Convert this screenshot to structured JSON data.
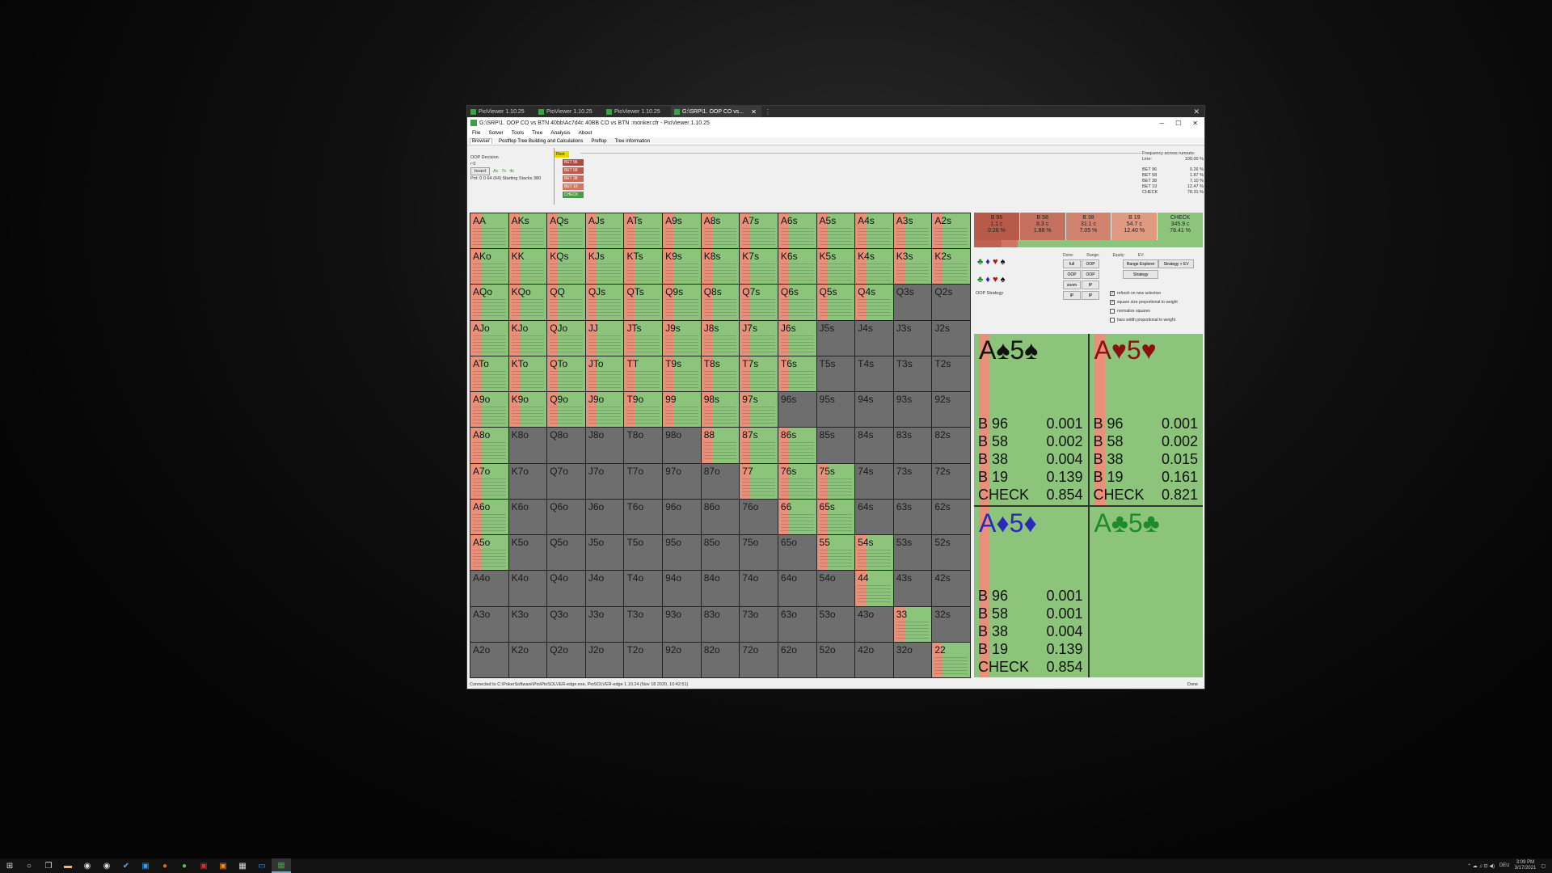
{
  "tabs": [
    {
      "label": "PioViewer 1.10.25",
      "active": false
    },
    {
      "label": "PioViewer 1.10.25",
      "active": false
    },
    {
      "label": "PioViewer 1.10.25",
      "active": false
    },
    {
      "label": "G:\\SRP\\1. OOP CO vs...",
      "active": true
    }
  ],
  "window_title": "G:\\SRP\\1. OOP CO vs BTN 40bb\\Ac7d4c 40BB CO vs BTN :monker.cfr - PioViewer 1.10.25",
  "menu": [
    "File",
    "Solver",
    "Tools",
    "Tree",
    "Analysis",
    "About"
  ],
  "subtabs": [
    "Browser",
    "Postflop Tree Building and Calculations",
    "Preflop",
    "Tree information"
  ],
  "info": {
    "decision": "OOP Decision",
    "line": "r:0",
    "board_btn": "board",
    "board_cards": [
      "Ac",
      "7c",
      "4c"
    ],
    "pot": "Pot: 0 0 64 (64) Starting Stacks 380"
  },
  "tree_nodes": [
    {
      "label": "Root",
      "color": "#e8d800"
    },
    {
      "label": "BET 96",
      "color": "#b04a3a"
    },
    {
      "label": "BET 58",
      "color": "#c05a48"
    },
    {
      "label": "BET 38",
      "color": "#c86a55"
    },
    {
      "label": "BET 19",
      "color": "#d07a65"
    },
    {
      "label": "CHECK",
      "color": "#4a9a4a"
    }
  ],
  "freq": {
    "title": "Frequency across runouts:",
    "line_label": "Line:",
    "line_value": "100.00 %",
    "rows": [
      {
        "name": "BET 96",
        "val": "0.26 %"
      },
      {
        "name": "BET 58",
        "val": "1.87 %"
      },
      {
        "name": "BET 38",
        "val": "7.10 %"
      },
      {
        "name": "BET 19",
        "val": "12.47 %"
      },
      {
        "name": "CHECK",
        "val": "78.31 %"
      }
    ]
  },
  "grid": [
    [
      "AA",
      "AKs",
      "AQs",
      "AJs",
      "ATs",
      "A9s",
      "A8s",
      "A7s",
      "A6s",
      "A5s",
      "A4s",
      "A3s",
      "A2s"
    ],
    [
      "AKo",
      "KK",
      "KQs",
      "KJs",
      "KTs",
      "K9s",
      "K8s",
      "K7s",
      "K6s",
      "K5s",
      "K4s",
      "K3s",
      "K2s"
    ],
    [
      "AQo",
      "KQo",
      "QQ",
      "QJs",
      "QTs",
      "Q9s",
      "Q8s",
      "Q7s",
      "Q6s",
      "Q5s",
      "Q4s",
      "Q3s",
      "Q2s"
    ],
    [
      "AJo",
      "KJo",
      "QJo",
      "JJ",
      "JTs",
      "J9s",
      "J8s",
      "J7s",
      "J6s",
      "J5s",
      "J4s",
      "J3s",
      "J2s"
    ],
    [
      "ATo",
      "KTo",
      "QTo",
      "JTo",
      "TT",
      "T9s",
      "T8s",
      "T7s",
      "T6s",
      "T5s",
      "T4s",
      "T3s",
      "T2s"
    ],
    [
      "A9o",
      "K9o",
      "Q9o",
      "J9o",
      "T9o",
      "99",
      "98s",
      "97s",
      "96s",
      "95s",
      "94s",
      "93s",
      "92s"
    ],
    [
      "A8o",
      "K8o",
      "Q8o",
      "J8o",
      "T8o",
      "98o",
      "88",
      "87s",
      "86s",
      "85s",
      "84s",
      "83s",
      "82s"
    ],
    [
      "A7o",
      "K7o",
      "Q7o",
      "J7o",
      "T7o",
      "97o",
      "87o",
      "77",
      "76s",
      "75s",
      "74s",
      "73s",
      "72s"
    ],
    [
      "A6o",
      "K6o",
      "Q6o",
      "J6o",
      "T6o",
      "96o",
      "86o",
      "76o",
      "66",
      "65s",
      "64s",
      "63s",
      "62s"
    ],
    [
      "A5o",
      "K5o",
      "Q5o",
      "J5o",
      "T5o",
      "95o",
      "85o",
      "75o",
      "65o",
      "55",
      "54s",
      "53s",
      "52s"
    ],
    [
      "A4o",
      "K4o",
      "Q4o",
      "J4o",
      "T4o",
      "94o",
      "84o",
      "74o",
      "64o",
      "54o",
      "44",
      "43s",
      "42s"
    ],
    [
      "A3o",
      "K3o",
      "Q3o",
      "J3o",
      "T3o",
      "93o",
      "83o",
      "73o",
      "63o",
      "53o",
      "43o",
      "33",
      "32s"
    ],
    [
      "A2o",
      "K2o",
      "Q2o",
      "J2o",
      "T2o",
      "92o",
      "82o",
      "72o",
      "62o",
      "52o",
      "42o",
      "32o",
      "22"
    ]
  ],
  "grid_active": [
    [
      1,
      1,
      1,
      1,
      1,
      1,
      1,
      1,
      1,
      1,
      1,
      1,
      1
    ],
    [
      1,
      1,
      1,
      1,
      1,
      1,
      1,
      1,
      1,
      1,
      1,
      1,
      1
    ],
    [
      1,
      1,
      1,
      1,
      1,
      1,
      1,
      1,
      1,
      1,
      1,
      0,
      0
    ],
    [
      1,
      1,
      1,
      1,
      1,
      1,
      1,
      1,
      1,
      0,
      0,
      0,
      0
    ],
    [
      1,
      1,
      1,
      1,
      1,
      1,
      1,
      1,
      1,
      0,
      0,
      0,
      0
    ],
    [
      1,
      1,
      1,
      1,
      1,
      1,
      1,
      1,
      0,
      0,
      0,
      0,
      0
    ],
    [
      1,
      0,
      0,
      0,
      0,
      0,
      1,
      1,
      1,
      0,
      0,
      0,
      0
    ],
    [
      1,
      0,
      0,
      0,
      0,
      0,
      0,
      1,
      1,
      1,
      0,
      0,
      0
    ],
    [
      1,
      0,
      0,
      0,
      0,
      0,
      0,
      0,
      1,
      1,
      0,
      0,
      0
    ],
    [
      1,
      0,
      0,
      0,
      0,
      0,
      0,
      0,
      0,
      1,
      1,
      0,
      0
    ],
    [
      0,
      0,
      0,
      0,
      0,
      0,
      0,
      0,
      0,
      0,
      1,
      0,
      0
    ],
    [
      0,
      0,
      0,
      0,
      0,
      0,
      0,
      0,
      0,
      0,
      0,
      1,
      0
    ],
    [
      0,
      0,
      0,
      0,
      0,
      0,
      0,
      0,
      0,
      0,
      0,
      0,
      1
    ]
  ],
  "actions": [
    {
      "label": "B 96",
      "combos": "1.1 c",
      "pct": "0.26 %",
      "color": "#b85a4a"
    },
    {
      "label": "B 58",
      "combos": "8.3 c",
      "pct": "1.88 %",
      "color": "#c4705e"
    },
    {
      "label": "B 38",
      "combos": "31.1 c",
      "pct": "7.05 %",
      "color": "#d08470"
    },
    {
      "label": "B 19",
      "combos": "54.7 c",
      "pct": "12.40 %",
      "color": "#e09a82"
    },
    {
      "label": "CHECK",
      "combos": "345.9 c",
      "pct": "78.41 %",
      "color": "#8cc47c"
    }
  ],
  "controls": {
    "heads": [
      "Done:",
      "Range:",
      "Equity:",
      "EV:"
    ],
    "row1": [
      "full",
      "OOP",
      "OOP",
      "OOP"
    ],
    "row2": [
      "zoom",
      "IP",
      "IP",
      "IP"
    ],
    "wide": [
      "Range Explorer",
      "Strategy + EV",
      "Strategy"
    ],
    "oop_strategy": "OOP Strategy",
    "checks": [
      {
        "label": "refresh on new selection",
        "checked": true
      },
      {
        "label": "square size proportional to weight",
        "checked": true
      },
      {
        "label": "normalize squares",
        "checked": false
      },
      {
        "label": "bars width proportional to weight",
        "checked": false
      }
    ]
  },
  "combos": [
    {
      "title": "A♠5♠",
      "color": "#111111",
      "empty": false,
      "rows": [
        [
          "B 96",
          "0.001"
        ],
        [
          "B 58",
          "0.002"
        ],
        [
          "B 38",
          "0.004"
        ],
        [
          "B 19",
          "0.139"
        ],
        [
          "CHECK",
          "0.854"
        ]
      ]
    },
    {
      "title": "A♥5♥",
      "color": "#8b1010",
      "empty": false,
      "rows": [
        [
          "B 96",
          "0.001"
        ],
        [
          "B 58",
          "0.002"
        ],
        [
          "B 38",
          "0.015"
        ],
        [
          "B 19",
          "0.161"
        ],
        [
          "CHECK",
          "0.821"
        ]
      ]
    },
    {
      "title": "A♦5♦",
      "color": "#2a2ab8",
      "empty": false,
      "rows": [
        [
          "B 96",
          "0.001"
        ],
        [
          "B 58",
          "0.001"
        ],
        [
          "B 38",
          "0.004"
        ],
        [
          "B 19",
          "0.139"
        ],
        [
          "CHECK",
          "0.854"
        ]
      ]
    },
    {
      "title": "A♣5♣",
      "color": "#1f8a2a",
      "empty": true,
      "rows": []
    }
  ],
  "status": {
    "left": "Connected to C:\\PokerSoftware\\Pio\\PioSOLVER-edge.exe, PioSOLVER-edge 1.10.24 (Nov 18 2020, 10:42:51)",
    "right": "Done"
  },
  "taskbar": {
    "time": "3:09 PM",
    "date": "3/17/2021",
    "lang": "DEU"
  }
}
